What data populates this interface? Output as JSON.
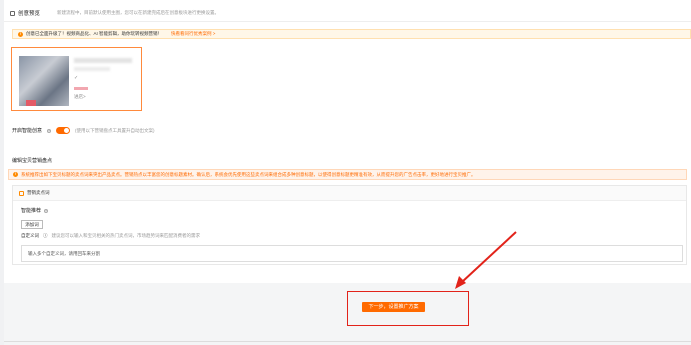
{
  "header": {
    "title": "创意预览",
    "description": "新建流程中，目前默认使用主图，您可以在新建完成后在创意板块进行更换设置。"
  },
  "tip_upgrade": {
    "badge": "!",
    "text": "创意已全面升级了！视频商品化、AI 智能剪辑，助你玩转视频营销！",
    "link": "快看看同行优秀案例 >"
  },
  "preview": {
    "enter_label": "进店>"
  },
  "smart_creative": {
    "label": "开启智能创意",
    "hint": "(使用以下营销盘点工具置升自动出文案)",
    "enabled": true
  },
  "section": {
    "title": "编辑宝贝营销盘点"
  },
  "tip_warning": {
    "text": "系统推荐出如下宝贝标题的卖点词来突出产品卖点。营销热点以丰富您的创意标题素材。确认后，系统会优先使用这些卖点词来组合成多种创意标题，以使得创意标题更精准有效，从而提升您的广告点击率，更好地进行宝贝推广。"
  },
  "card": {
    "title": "营销卖点词",
    "smart_recommend_label": "智能推荐",
    "add_button": "添加词",
    "custom_label": "自定义词",
    "custom_hint": "建议您可以输入和宝贝相关的热门卖点词，市场趋势词来匹配消费者的需求",
    "input_value": "输入多个自定义词，请用回车来分割"
  },
  "footer": {
    "next_button": "下一步，设置推广方案"
  },
  "colors": {
    "accent": "#ff6a00",
    "highlight": "#e2231a"
  }
}
